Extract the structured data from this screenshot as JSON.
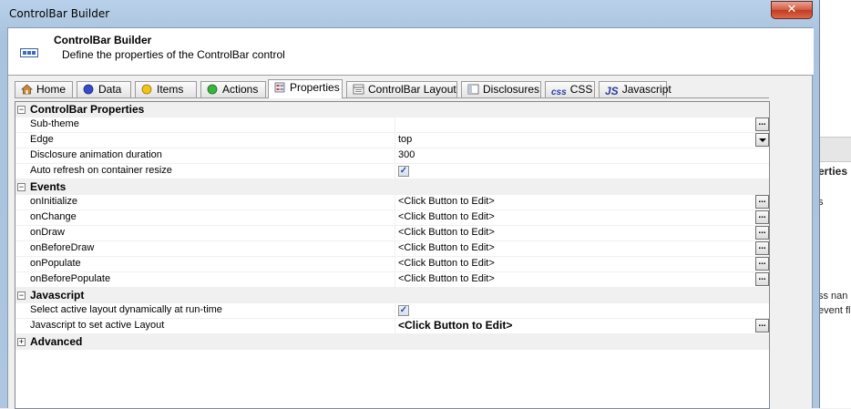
{
  "window": {
    "title": "ControlBar Builder",
    "close_glyph": "✕"
  },
  "header": {
    "title": "ControlBar Builder",
    "subtitle": "Define the properties of the ControlBar control"
  },
  "tabs": [
    {
      "label": "Home",
      "icon": "home-icon"
    },
    {
      "label": "Data",
      "icon": "blue-circle-icon"
    },
    {
      "label": "Items",
      "icon": "yellow-circle-icon"
    },
    {
      "label": "Actions",
      "icon": "green-circle-icon"
    },
    {
      "label": "Properties",
      "icon": "properties-icon",
      "active": true
    },
    {
      "label": "ControlBar Layout",
      "icon": "layout-icon"
    },
    {
      "label": "Disclosures",
      "icon": "disclosures-icon"
    },
    {
      "label": "CSS",
      "icon": "css-icon",
      "icon_text": "css"
    },
    {
      "label": "Javascript",
      "icon": "js-icon",
      "icon_text": "JS"
    }
  ],
  "grid": {
    "categories": {
      "controlbar": "ControlBar Properties",
      "events": "Events",
      "javascript": "Javascript",
      "advanced": "Advanced"
    },
    "toggle_minus": "−",
    "toggle_plus": "+",
    "ellipsis": "...",
    "check": "✓",
    "controlbar_rows": [
      {
        "name": "Sub-theme",
        "value": ""
      },
      {
        "name": "Edge",
        "value": "top"
      },
      {
        "name": "Disclosure animation duration",
        "value": "300"
      },
      {
        "name": "Auto refresh on container resize",
        "value": "checked"
      }
    ],
    "event_rows": [
      {
        "name": "onInitialize",
        "value": "<Click Button to Edit>"
      },
      {
        "name": "onChange",
        "value": "<Click Button to Edit>"
      },
      {
        "name": "onDraw",
        "value": "<Click Button to Edit>"
      },
      {
        "name": "onBeforeDraw",
        "value": "<Click Button to Edit>"
      },
      {
        "name": "onPopulate",
        "value": "<Click Button to Edit>"
      },
      {
        "name": "onBeforePopulate",
        "value": "<Click Button to Edit>"
      }
    ],
    "javascript_rows": [
      {
        "name": "Select active layout dynamically at run-time",
        "value": "checked"
      },
      {
        "name": "Javascript to set active Layout",
        "value": "<Click Button to Edit>"
      }
    ]
  },
  "background_app": {
    "text1": "erties",
    "text2": "s",
    "text3": "ss nan",
    "text4": "event fl"
  },
  "colors": {
    "title_bar": "#b9d1ea",
    "close_button": "#c13b22",
    "grid_category": "#f0f0f0",
    "link_blue": "#2a4f8e"
  }
}
